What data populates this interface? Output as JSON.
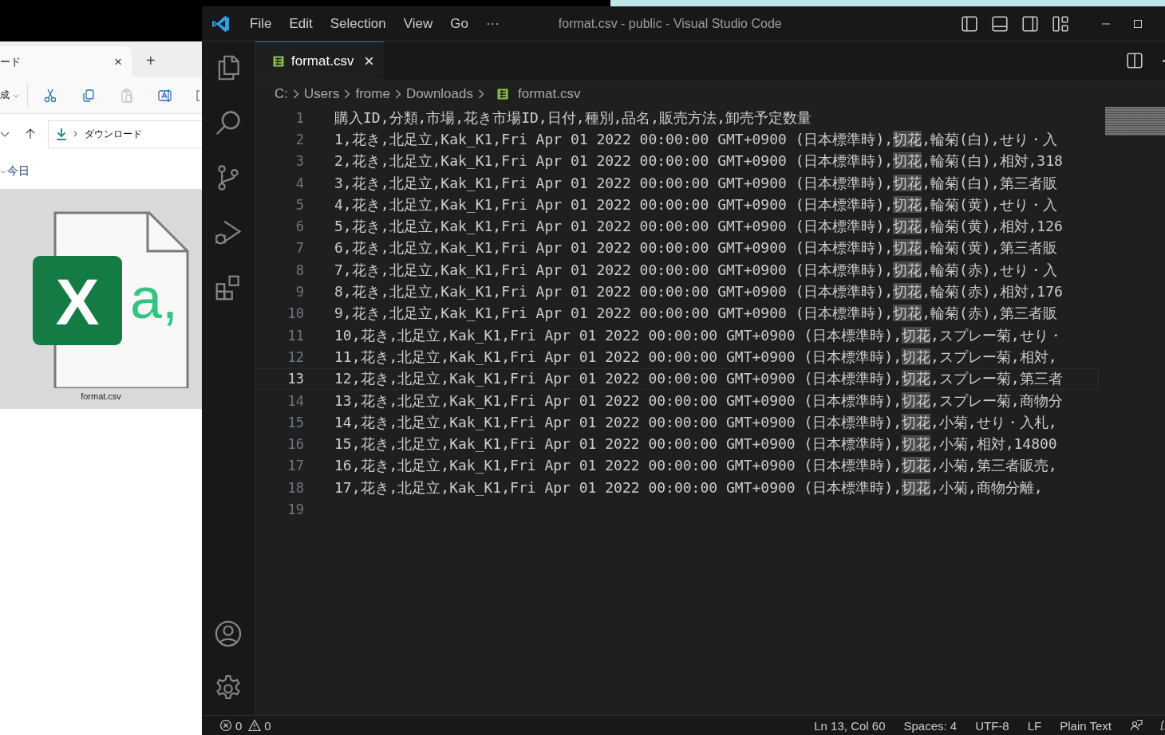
{
  "explorer": {
    "tab": {
      "title": "ード",
      "close": "×"
    },
    "new_tab": "+",
    "toolbar": {
      "new_label": "成"
    },
    "address": {
      "path": "ダウンロード"
    },
    "group": {
      "label": "今日"
    },
    "files": [
      {
        "name": "format.csv",
        "selected": true,
        "icon_badge": "X",
        "icon_mark": "a,"
      }
    ]
  },
  "window": {
    "title": "format.csv - public - Visual Studio Code"
  },
  "menu": [
    "File",
    "Edit",
    "Selection",
    "View",
    "Go",
    "···"
  ],
  "tabs": [
    {
      "label": "format.csv",
      "selected": true
    }
  ],
  "breadcrumb": [
    "C:",
    "Users",
    "frome",
    "Downloads",
    "format.csv"
  ],
  "editor": {
    "lines": [
      {
        "number": "1",
        "text": "購入ID,分類,市場,花き市場ID,日付,種別,品名,販売方法,卸売予定数量",
        "selected": false
      },
      {
        "number": "2",
        "text": "1,花き,北足立,Kak_K1,Fri Apr 01 2022 00:00:00 GMT+0900 (日本標準時),",
        "match": "切花",
        "rest": ",輪菊(白),せり・入",
        "selected": false
      },
      {
        "number": "3",
        "text": "2,花き,北足立,Kak_K1,Fri Apr 01 2022 00:00:00 GMT+0900 (日本標準時),",
        "match": "切花",
        "rest": ",輪菊(白),相対,318",
        "selected": false
      },
      {
        "number": "4",
        "text": "3,花き,北足立,Kak_K1,Fri Apr 01 2022 00:00:00 GMT+0900 (日本標準時),",
        "match": "切花",
        "rest": ",輪菊(白),第三者販",
        "selected": false
      },
      {
        "number": "5",
        "text": "4,花き,北足立,Kak_K1,Fri Apr 01 2022 00:00:00 GMT+0900 (日本標準時),",
        "match": "切花",
        "rest": ",輪菊(黄),せり・入",
        "selected": false
      },
      {
        "number": "6",
        "text": "5,花き,北足立,Kak_K1,Fri Apr 01 2022 00:00:00 GMT+0900 (日本標準時),",
        "match": "切花",
        "rest": ",輪菊(黄),相対,126",
        "selected": false
      },
      {
        "number": "7",
        "text": "6,花き,北足立,Kak_K1,Fri Apr 01 2022 00:00:00 GMT+0900 (日本標準時),",
        "match": "切花",
        "rest": ",輪菊(黄),第三者販",
        "selected": false
      },
      {
        "number": "8",
        "text": "7,花き,北足立,Kak_K1,Fri Apr 01 2022 00:00:00 GMT+0900 (日本標準時),",
        "match": "切花",
        "rest": ",輪菊(赤),せり・入",
        "selected": false
      },
      {
        "number": "9",
        "text": "8,花き,北足立,Kak_K1,Fri Apr 01 2022 00:00:00 GMT+0900 (日本標準時),",
        "match": "切花",
        "rest": ",輪菊(赤),相対,176",
        "selected": false
      },
      {
        "number": "10",
        "text": "9,花き,北足立,Kak_K1,Fri Apr 01 2022 00:00:00 GMT+0900 (日本標準時),",
        "match": "切花",
        "rest": ",輪菊(赤),第三者販",
        "selected": false
      },
      {
        "number": "11",
        "text": "10,花き,北足立,Kak_K1,Fri Apr 01 2022 00:00:00 GMT+0900 (日本標準時),",
        "match": "切花",
        "rest": ",スプレー菊,せり・",
        "selected": false
      },
      {
        "number": "12",
        "text": "11,花き,北足立,Kak_K1,Fri Apr 01 2022 00:00:00 GMT+0900 (日本標準時),",
        "match": "切花",
        "rest": ",スプレー菊,相対,",
        "selected": false
      },
      {
        "number": "13",
        "text": "12,花き,北足立,Kak_K1,Fri Apr 01 2022 00:00:00 GMT+0900 (日本標準時),",
        "match": "切花",
        "rest": ",スプレー菊,第三者",
        "selected": true
      },
      {
        "number": "14",
        "text": "13,花き,北足立,Kak_K1,Fri Apr 01 2022 00:00:00 GMT+0900 (日本標準時),",
        "match": "切花",
        "rest": ",スプレー菊,商物分",
        "selected": false
      },
      {
        "number": "15",
        "text": "14,花き,北足立,Kak_K1,Fri Apr 01 2022 00:00:00 GMT+0900 (日本標準時),",
        "match": "切花",
        "rest": ",小菊,せり・入札,",
        "selected": false
      },
      {
        "number": "16",
        "text": "15,花き,北足立,Kak_K1,Fri Apr 01 2022 00:00:00 GMT+0900 (日本標準時),",
        "match": "切花",
        "rest": ",小菊,相対,14800",
        "selected": false
      },
      {
        "number": "17",
        "text": "16,花き,北足立,Kak_K1,Fri Apr 01 2022 00:00:00 GMT+0900 (日本標準時),",
        "match": "切花",
        "rest": ",小菊,第三者販売,",
        "selected": false
      },
      {
        "number": "18",
        "text": "17,花き,北足立,Kak_K1,Fri Apr 01 2022 00:00:00 GMT+0900 (日本標準時),",
        "match": "切花",
        "rest": ",小菊,商物分離,",
        "selected": false
      },
      {
        "number": "19",
        "selected": false
      }
    ]
  },
  "status_bar": {
    "errors": "0",
    "warnings": "0",
    "items": [
      "Ln 13, Col 60",
      "Spaces: 4",
      "UTF-8",
      "LF",
      "Plain Text"
    ]
  }
}
